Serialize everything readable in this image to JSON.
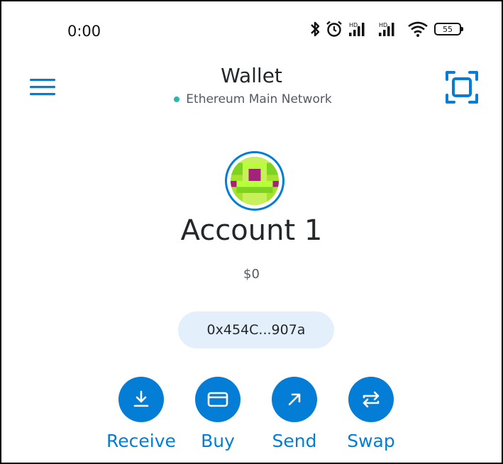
{
  "status_bar": {
    "time": "0:00",
    "battery": "55",
    "icons": [
      "bluetooth-icon",
      "alarm-icon",
      "hd-signal-icon",
      "hd-signal-icon",
      "wifi-icon",
      "battery-icon"
    ]
  },
  "header": {
    "title": "Wallet",
    "network": "Ethereum Main Network",
    "network_dot_color": "#29b6af",
    "menu_icon": "hamburger-menu-icon",
    "scan_icon": "scan-qr-icon"
  },
  "account": {
    "name": "Account 1",
    "balance": "$0",
    "address": "0x454C...907a"
  },
  "actions": [
    {
      "label": "Receive",
      "icon": "receive-download-icon"
    },
    {
      "label": "Buy",
      "icon": "card-icon"
    },
    {
      "label": "Send",
      "icon": "send-arrow-icon"
    },
    {
      "label": "Swap",
      "icon": "swap-icon"
    }
  ],
  "colors": {
    "accent": "#037dd6",
    "address_bg": "#e3f0fb",
    "text": "#24272a"
  }
}
